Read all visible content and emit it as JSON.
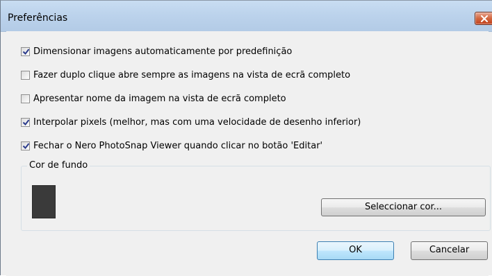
{
  "window": {
    "title": "Preferências"
  },
  "options": [
    {
      "label": "Dimensionar imagens automaticamente por predefinição",
      "checked": true
    },
    {
      "label": "Fazer duplo clique abre sempre as imagens na vista de ecrã completo",
      "checked": false
    },
    {
      "label": "Apresentar nome da imagem na vista de ecrã completo",
      "checked": false
    },
    {
      "label": "Interpolar pixels (melhor, mas com uma velocidade de desenho inferior)",
      "checked": true
    },
    {
      "label": "Fechar o Nero PhotoSnap Viewer quando clicar no botão 'Editar'",
      "checked": true
    }
  ],
  "background_color": {
    "group_label": "Cor de fundo",
    "swatch_color": "#3a3a3a",
    "select_button": "Seleccionar cor..."
  },
  "buttons": {
    "ok": "OK",
    "cancel": "Cancelar"
  },
  "icons": {
    "close": "close-icon",
    "check": "checkmark-icon"
  }
}
